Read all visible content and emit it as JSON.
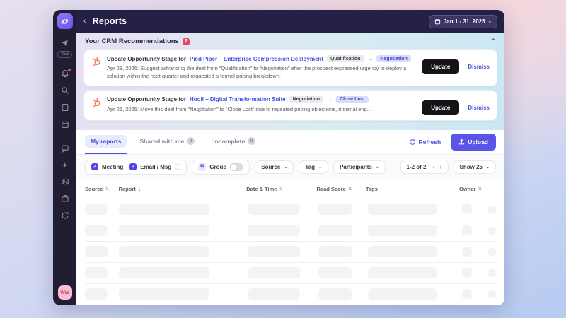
{
  "colors": {
    "accent": "#5b54e8",
    "topbar": "#241f45",
    "sidebar": "#211d33",
    "hubspot_orange": "#ff7a59",
    "alert_red": "#e8485a",
    "avatar_pink": "#f8bfd2"
  },
  "sidebar": {
    "trial_label": "Trial",
    "avatar_initials": "WW",
    "icons": [
      "logo",
      "assistant-send",
      "notifications-bell",
      "search",
      "library-book",
      "calendar",
      "chat",
      "zap",
      "gallery",
      "briefcase",
      "sync"
    ]
  },
  "topbar": {
    "title": "Reports",
    "back_glyph": "‹",
    "date_range": "Jan 1 - 31, 2025",
    "date_chevron": "⌄"
  },
  "recommendations": {
    "title": "Your CRM Recommendations",
    "count": "2",
    "collapse_glyph": "⌃",
    "items": [
      {
        "title_prefix": "Update Opportunity Stage for",
        "title_link": "Pied Piper – Enterprise Compression Deployment",
        "from_stage": "Qualification",
        "arrow": "→",
        "to_stage": "Negotiation",
        "description": "Apr 28, 2025: Suggest advancing the deal from “Qualification” to “Negotiation” after the prospect expressed urgency to deploy a solution within the next quarter and requested a formal pricing breakdown.",
        "update_label": "Update",
        "dismiss_label": "Dismiss"
      },
      {
        "title_prefix": "Update Opportunity Stage for",
        "title_link": "Hooli – Digital Transformation Suite",
        "from_stage": "Negotiation",
        "arrow": "→",
        "to_stage": "Close Lost",
        "description": "Apr 25, 2025: Move this deal from “Negotiation” to “Close Lost” due to repeated pricing objections, minimal eng...",
        "update_label": "Update",
        "dismiss_label": "Dismiss"
      }
    ]
  },
  "tabs": [
    {
      "label": "My reports",
      "active": true
    },
    {
      "label": "Shared with me",
      "badge": "0"
    },
    {
      "label": "Incomplete",
      "badge": "0"
    }
  ],
  "toolbar": {
    "refresh_label": "Refresh",
    "upload_label": "Upload"
  },
  "filters": {
    "meeting_label": "Meeting",
    "email_label": "Email / Msg",
    "info_glyph": "ⓘ",
    "group_label": "Group",
    "source_label": "Source",
    "tag_label": "Tag",
    "participants_label": "Participants",
    "pagination": "1-2 of 2",
    "prev_glyph": "‹",
    "next_glyph": "›",
    "show_label": "Show 25",
    "chevron": "⌄"
  },
  "table": {
    "columns": [
      {
        "label": "Source"
      },
      {
        "label": "Report"
      },
      {
        "label": "Date & Time"
      },
      {
        "label": "Read Score"
      },
      {
        "label": "Tags"
      },
      {
        "label": "Owner"
      }
    ],
    "sorted_column": "Report",
    "sorted_glyph": "↓",
    "skeleton_rows": 5
  }
}
